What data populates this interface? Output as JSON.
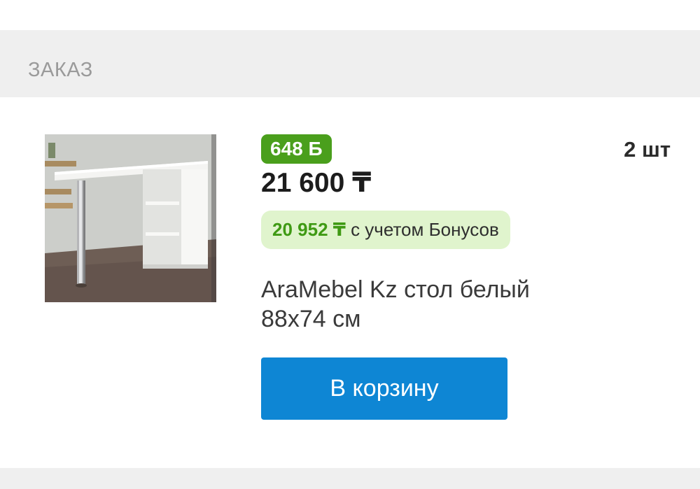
{
  "section": {
    "title": "ЗАКАЗ"
  },
  "product": {
    "image_alt": "AraMebel Kz стол белый 88х74 см",
    "bonus_badge": "648 Б",
    "price": "21 600 ₸",
    "quantity": "2 шт",
    "bonus_price_value": "20 952 ₸",
    "bonus_price_note": "с учетом Бонусов",
    "name": "AraMebel Kz стол белый 88х74 см"
  },
  "actions": {
    "add_to_cart_label": "В корзину"
  },
  "colors": {
    "header_bg": "#efefef",
    "bonus_green": "#4a9f1c",
    "bonus_pill_bg": "#e0f4cd",
    "button_blue": "#0e86d4"
  }
}
